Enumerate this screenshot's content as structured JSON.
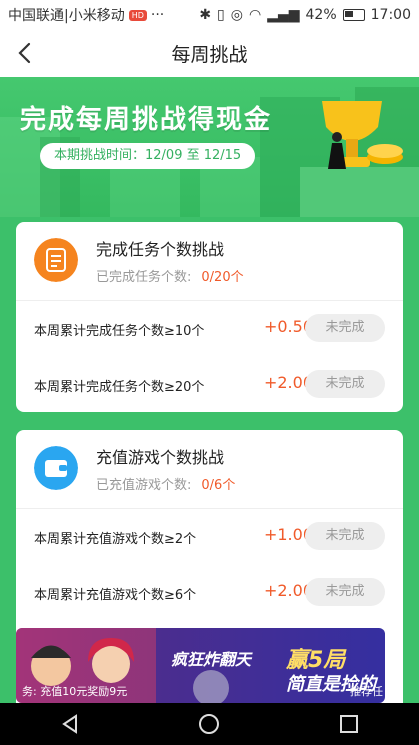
{
  "status_bar": {
    "carrier": "中国联通|小米移动",
    "badge": "HD",
    "dots": "···",
    "battery": "42%",
    "time": "17:00"
  },
  "nav": {
    "title": "每周挑战"
  },
  "hero": {
    "headline": "完成每周挑战得现金",
    "period": "本期挑战时间：12/09 至 12/15"
  },
  "tasks": {
    "title": "完成任务个数挑战",
    "subtitle": "已完成任务个数:",
    "progress": "0/20个",
    "rows": [
      {
        "label": "本周累计完成任务个数≥10个",
        "reward": "+0.50",
        "status": "未完成"
      },
      {
        "label": "本周累计完成任务个数≥20个",
        "reward": "+2.00",
        "status": "未完成"
      }
    ]
  },
  "games": {
    "title": "充值游戏个数挑战",
    "subtitle": "已充值游戏个数:",
    "progress": "0/6个",
    "rows": [
      {
        "label": "本周累计充值游戏个数≥2个",
        "reward": "+1.00",
        "status": "未完成"
      },
      {
        "label": "本周累计充值游戏个数≥6个",
        "reward": "+2.00",
        "status": "未完成"
      }
    ]
  },
  "banner": {
    "caption_left": "务: 充值10元奖励9元",
    "caption_right": "推荐任",
    "slogan1": "疯狂炸翻天",
    "slogan2": "赢5局",
    "slogan3": "简直是捡的"
  },
  "colors": {
    "accent": "#3cc06a",
    "reward": "#f05a2a",
    "tasks_icon": "#f5841f",
    "games_icon": "#2aa6f0"
  }
}
